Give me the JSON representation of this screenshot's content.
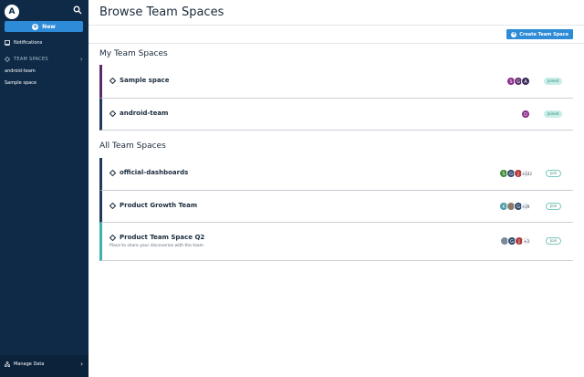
{
  "sidebar": {
    "new_label": "New",
    "notifications_label": "Notifications",
    "team_spaces_label": "TEAM SPACES",
    "teams": [
      "android-team",
      "Sample space"
    ],
    "manage_data_label": "Manage Data"
  },
  "header": {
    "title": "Browse Team Spaces",
    "create_label": "Create Team Space"
  },
  "sections": {
    "my_title": "My Team Spaces",
    "all_title": "All Team Spaces"
  },
  "my_spaces": [
    {
      "name": "Sample space",
      "status": "Joined"
    },
    {
      "name": "android-team",
      "status": "Joined"
    }
  ],
  "all_spaces": [
    {
      "name": "official-dashboards",
      "more": "+142",
      "action": "Join"
    },
    {
      "name": "Product Growth Team",
      "more": "+29",
      "action": "Join"
    },
    {
      "name": "Product Team Space Q2",
      "description": "Place to share your discoveries with the team",
      "more": "+3",
      "action": "Join"
    }
  ],
  "colors": {
    "sidebar_bg": "#0e2a47",
    "accent": "#2e8bd8",
    "purple_bar": "#5a2d6a",
    "navy_bar": "#1f3a5c",
    "teal_bar": "#3bb3a8",
    "joined_badge": "#c9eee8"
  },
  "avatars": {
    "sample_space": [
      "S",
      "G",
      "A"
    ],
    "android_team": [
      "D"
    ],
    "official_dashboards": [
      "S",
      "G",
      "J"
    ],
    "product_growth": [
      "K",
      "",
      "G"
    ],
    "product_team_q2": [
      "",
      "G",
      "J"
    ]
  },
  "icons": {
    "logo": "amplitude-logo",
    "search": "search-icon",
    "notifications": "notifications-icon",
    "team_spaces": "team-spaces-icon",
    "manage_data": "manage-data-icon",
    "space": "team-space-icon",
    "chevron": "chevron-right-icon"
  }
}
